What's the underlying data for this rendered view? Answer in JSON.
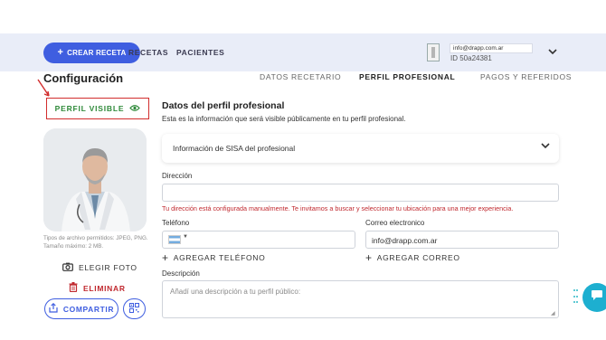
{
  "header": {
    "create_label": "CREAR RECETA",
    "nav": [
      "RECETAS",
      "PACIENTES"
    ],
    "user_email": "info@drapp.com.ar",
    "user_id": "ID 50a24381"
  },
  "page": {
    "title": "Configuración",
    "tabs": [
      "DATOS RECETARIO",
      "PERFIL PROFESIONAL",
      "PAGOS Y REFERIDOS"
    ],
    "active_tab": "PERFIL PROFESIONAL"
  },
  "left": {
    "visible_label": "PERFIL VISIBLE",
    "file_types": "Tipos de archivo permitidos: JPEG, PNG. Tamaño máximo: 2 MB.",
    "choose_photo": "ELEGIR FOTO",
    "delete": "ELIMINAR",
    "share": "COMPARTIR"
  },
  "form": {
    "section_title": "Datos del perfil profesional",
    "section_subtitle": "Esta es la información que será visible públicamente en tu perfil profesional.",
    "sisa_label": "Información de SISA del profesional",
    "address_label": "Dirección",
    "address_value": "",
    "address_warning": "Tu dirección está configurada manualmente. Te invitamos a buscar y seleccionar tu ubicación para una mejor experiencia.",
    "phone_label": "Teléfono",
    "email_label": "Correo electronico",
    "email_value": "info@drapp.com.ar",
    "add_phone": "AGREGAR TELÉFONO",
    "add_email": "AGREGAR CORREO",
    "description_label": "Descripción",
    "description_placeholder": "Añadí una descripción a tu perfil público:"
  },
  "colors": {
    "primary": "#3f5ee0",
    "visible_green": "#2f8a3a",
    "danger": "#c0292f",
    "chat": "#1dafd0"
  }
}
